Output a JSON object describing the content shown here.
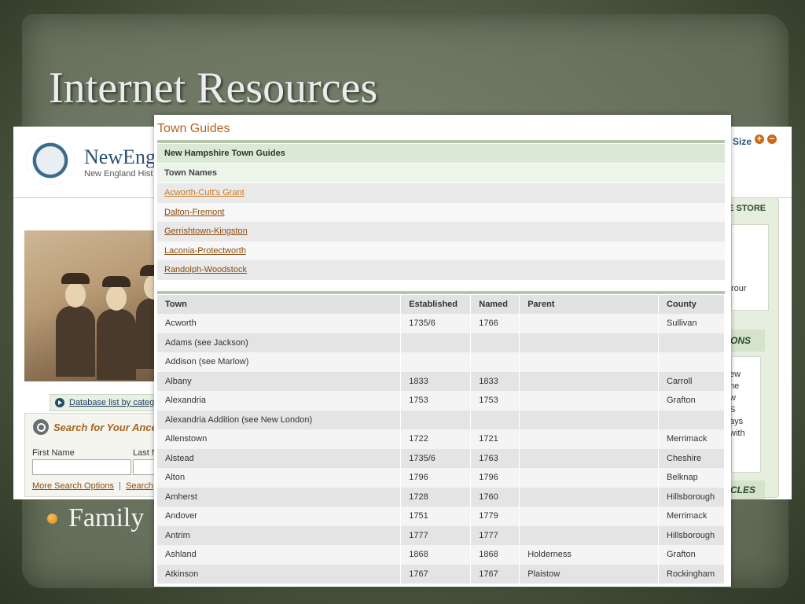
{
  "slide": {
    "title": "Internet Resources",
    "bullet": "Family"
  },
  "site": {
    "name": "NewEng",
    "subtitle": "New England Hist",
    "size_label": "Size",
    "store_label": "IE STORE",
    "rail_text": "rour",
    "rail_heading_2": "ONS",
    "rail_lines": [
      "ew",
      "ne",
      "w",
      "S",
      "ays",
      "with"
    ],
    "rail_heading_3": "CLES",
    "database_link": "Database list by catego",
    "search": {
      "title": "Search for Your Ancest",
      "first_name_label": "First Name",
      "last_name_label": "Last N",
      "first_name_value": "",
      "last_name_value": "",
      "more_options": "More Search Options",
      "separator": "|",
      "search_link": "Search"
    }
  },
  "guides": {
    "title": "Town Guides",
    "state_heading": "New Hampshire Town Guides",
    "names_heading": "Town Names",
    "town_name_links": [
      "Acworth-Cutt's Grant",
      "Dalton-Fremont",
      "Gerrishtown-Kingston",
      "Laconia-Protectworth",
      "Randolph-Woodstock"
    ],
    "table": {
      "headers": [
        "Town",
        "Established",
        "Named",
        "Parent",
        "County"
      ],
      "rows": [
        [
          "Acworth",
          "1735/6",
          "1766",
          "",
          "Sullivan"
        ],
        [
          "Adams (see Jackson)",
          "",
          "",
          "",
          ""
        ],
        [
          "Addison (see Marlow)",
          "",
          "",
          "",
          ""
        ],
        [
          "Albany",
          "1833",
          "1833",
          "",
          "Carroll"
        ],
        [
          "Alexandria",
          "1753",
          "1753",
          "",
          "Grafton"
        ],
        [
          "Alexandria Addition (see New London)",
          "",
          "",
          "",
          ""
        ],
        [
          "Allenstown",
          "1722",
          "1721",
          "",
          "Merrimack"
        ],
        [
          "Alstead",
          "1735/6",
          "1763",
          "",
          "Cheshire"
        ],
        [
          "Alton",
          "1796",
          "1796",
          "",
          "Belknap"
        ],
        [
          "Amherst",
          "1728",
          "1760",
          "",
          "Hillsborough"
        ],
        [
          "Andover",
          "1751",
          "1779",
          "",
          "Merrimack"
        ],
        [
          "Antrim",
          "1777",
          "1777",
          "",
          "Hillsborough"
        ],
        [
          "Ashland",
          "1868",
          "1868",
          "Holderness",
          "Grafton"
        ],
        [
          "Atkinson",
          "1767",
          "1767",
          "Plaistow",
          "Rockingham"
        ]
      ]
    }
  }
}
